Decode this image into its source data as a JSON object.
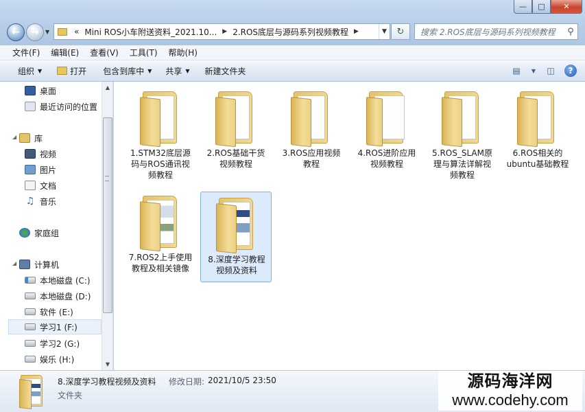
{
  "window": {
    "controls": {
      "minimize": "—",
      "maximize": "□",
      "close": "✕"
    }
  },
  "address": {
    "prefix": "«",
    "crumbs": [
      "Mini ROS小车附送资料_2021.10...",
      "2.ROS底层与源码系列视频教程"
    ]
  },
  "search": {
    "placeholder": "搜索 2.ROS底层与源码系列视频教程"
  },
  "menubar": [
    "文件(F)",
    "编辑(E)",
    "查看(V)",
    "工具(T)",
    "帮助(H)"
  ],
  "toolbar": {
    "organize": "组织",
    "open": "打开",
    "include_library": "包含到库中",
    "share": "共享",
    "new_folder": "新建文件夹"
  },
  "nav": {
    "favorites": [
      "桌面",
      "最近访问的位置"
    ],
    "library_header": "库",
    "libraries": [
      "视频",
      "图片",
      "文档",
      "音乐"
    ],
    "homegroup": "家庭组",
    "computer_header": "计算机",
    "drives": [
      "本地磁盘 (C:)",
      "本地磁盘 (D:)",
      "软件 (E:)",
      "学习1 (F:)",
      "学习2 (G:)",
      "娱乐 (H:)"
    ],
    "selected_drive": "学习1 (F:)"
  },
  "items": [
    {
      "line1": "1.STM32底层源",
      "line2": "码与ROS通讯视",
      "line3": "频教程",
      "thumb": "paper"
    },
    {
      "line1": "2.ROS基础干货",
      "line2": "视频教程",
      "line3": "",
      "thumb": "paper"
    },
    {
      "line1": "3.ROS应用视频",
      "line2": "教程",
      "line3": "",
      "thumb": "paper"
    },
    {
      "line1": "4.ROS进阶应用",
      "line2": "视频教程",
      "line3": "",
      "thumb": "paper"
    },
    {
      "line1": "5.ROS_SLAM原",
      "line2": "理与算法详解视",
      "line3": "频教程",
      "thumb": "paper"
    },
    {
      "line1": "6.ROS相关的",
      "line2": "ubuntu基础教程",
      "line3": "",
      "thumb": "paper"
    },
    {
      "line1": "7.ROS2上手使用",
      "line2": "教程及相关镜像",
      "line3": "",
      "thumb": "img2"
    },
    {
      "line1": "8.深度学习教程",
      "line2": "视频及资料",
      "line3": "",
      "thumb": "img",
      "selected": true
    }
  ],
  "details": {
    "name": "8.深度学习教程视频及资料",
    "date_label": "修改日期:",
    "date": "2021/10/5 23:50",
    "type": "文件夹"
  },
  "watermark": {
    "line1": "源码海洋网",
    "line2": "www.codehy.com"
  },
  "colors": {
    "selection": "#dcebfb",
    "selection_border": "#84acdd",
    "folder": "#e8c65c",
    "accent": "#1f5fb0"
  }
}
